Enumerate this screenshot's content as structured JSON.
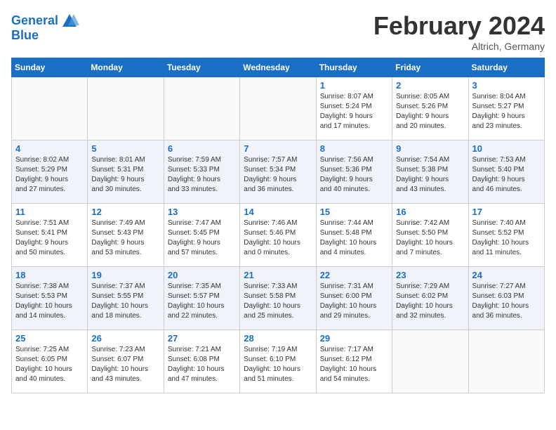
{
  "header": {
    "logo_line1": "General",
    "logo_line2": "Blue",
    "month": "February 2024",
    "location": "Altrich, Germany"
  },
  "weekdays": [
    "Sunday",
    "Monday",
    "Tuesday",
    "Wednesday",
    "Thursday",
    "Friday",
    "Saturday"
  ],
  "weeks": [
    [
      {
        "day": "",
        "info": ""
      },
      {
        "day": "",
        "info": ""
      },
      {
        "day": "",
        "info": ""
      },
      {
        "day": "",
        "info": ""
      },
      {
        "day": "1",
        "info": "Sunrise: 8:07 AM\nSunset: 5:24 PM\nDaylight: 9 hours\nand 17 minutes."
      },
      {
        "day": "2",
        "info": "Sunrise: 8:05 AM\nSunset: 5:26 PM\nDaylight: 9 hours\nand 20 minutes."
      },
      {
        "day": "3",
        "info": "Sunrise: 8:04 AM\nSunset: 5:27 PM\nDaylight: 9 hours\nand 23 minutes."
      }
    ],
    [
      {
        "day": "4",
        "info": "Sunrise: 8:02 AM\nSunset: 5:29 PM\nDaylight: 9 hours\nand 27 minutes."
      },
      {
        "day": "5",
        "info": "Sunrise: 8:01 AM\nSunset: 5:31 PM\nDaylight: 9 hours\nand 30 minutes."
      },
      {
        "day": "6",
        "info": "Sunrise: 7:59 AM\nSunset: 5:33 PM\nDaylight: 9 hours\nand 33 minutes."
      },
      {
        "day": "7",
        "info": "Sunrise: 7:57 AM\nSunset: 5:34 PM\nDaylight: 9 hours\nand 36 minutes."
      },
      {
        "day": "8",
        "info": "Sunrise: 7:56 AM\nSunset: 5:36 PM\nDaylight: 9 hours\nand 40 minutes."
      },
      {
        "day": "9",
        "info": "Sunrise: 7:54 AM\nSunset: 5:38 PM\nDaylight: 9 hours\nand 43 minutes."
      },
      {
        "day": "10",
        "info": "Sunrise: 7:53 AM\nSunset: 5:40 PM\nDaylight: 9 hours\nand 46 minutes."
      }
    ],
    [
      {
        "day": "11",
        "info": "Sunrise: 7:51 AM\nSunset: 5:41 PM\nDaylight: 9 hours\nand 50 minutes."
      },
      {
        "day": "12",
        "info": "Sunrise: 7:49 AM\nSunset: 5:43 PM\nDaylight: 9 hours\nand 53 minutes."
      },
      {
        "day": "13",
        "info": "Sunrise: 7:47 AM\nSunset: 5:45 PM\nDaylight: 9 hours\nand 57 minutes."
      },
      {
        "day": "14",
        "info": "Sunrise: 7:46 AM\nSunset: 5:46 PM\nDaylight: 10 hours\nand 0 minutes."
      },
      {
        "day": "15",
        "info": "Sunrise: 7:44 AM\nSunset: 5:48 PM\nDaylight: 10 hours\nand 4 minutes."
      },
      {
        "day": "16",
        "info": "Sunrise: 7:42 AM\nSunset: 5:50 PM\nDaylight: 10 hours\nand 7 minutes."
      },
      {
        "day": "17",
        "info": "Sunrise: 7:40 AM\nSunset: 5:52 PM\nDaylight: 10 hours\nand 11 minutes."
      }
    ],
    [
      {
        "day": "18",
        "info": "Sunrise: 7:38 AM\nSunset: 5:53 PM\nDaylight: 10 hours\nand 14 minutes."
      },
      {
        "day": "19",
        "info": "Sunrise: 7:37 AM\nSunset: 5:55 PM\nDaylight: 10 hours\nand 18 minutes."
      },
      {
        "day": "20",
        "info": "Sunrise: 7:35 AM\nSunset: 5:57 PM\nDaylight: 10 hours\nand 22 minutes."
      },
      {
        "day": "21",
        "info": "Sunrise: 7:33 AM\nSunset: 5:58 PM\nDaylight: 10 hours\nand 25 minutes."
      },
      {
        "day": "22",
        "info": "Sunrise: 7:31 AM\nSunset: 6:00 PM\nDaylight: 10 hours\nand 29 minutes."
      },
      {
        "day": "23",
        "info": "Sunrise: 7:29 AM\nSunset: 6:02 PM\nDaylight: 10 hours\nand 32 minutes."
      },
      {
        "day": "24",
        "info": "Sunrise: 7:27 AM\nSunset: 6:03 PM\nDaylight: 10 hours\nand 36 minutes."
      }
    ],
    [
      {
        "day": "25",
        "info": "Sunrise: 7:25 AM\nSunset: 6:05 PM\nDaylight: 10 hours\nand 40 minutes."
      },
      {
        "day": "26",
        "info": "Sunrise: 7:23 AM\nSunset: 6:07 PM\nDaylight: 10 hours\nand 43 minutes."
      },
      {
        "day": "27",
        "info": "Sunrise: 7:21 AM\nSunset: 6:08 PM\nDaylight: 10 hours\nand 47 minutes."
      },
      {
        "day": "28",
        "info": "Sunrise: 7:19 AM\nSunset: 6:10 PM\nDaylight: 10 hours\nand 51 minutes."
      },
      {
        "day": "29",
        "info": "Sunrise: 7:17 AM\nSunset: 6:12 PM\nDaylight: 10 hours\nand 54 minutes."
      },
      {
        "day": "",
        "info": ""
      },
      {
        "day": "",
        "info": ""
      }
    ]
  ]
}
